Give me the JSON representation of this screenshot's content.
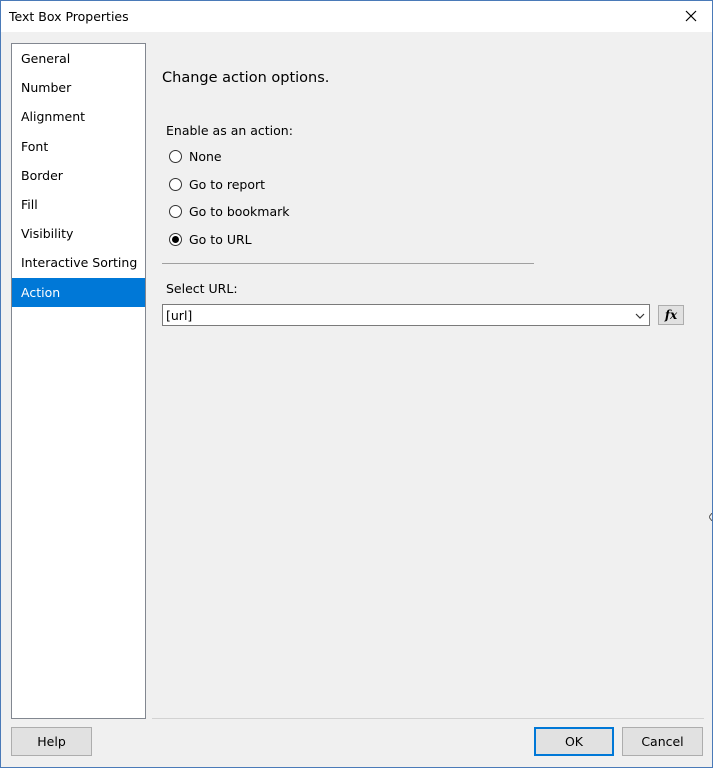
{
  "window": {
    "title": "Text Box Properties"
  },
  "nav": {
    "items": [
      {
        "label": "General"
      },
      {
        "label": "Number"
      },
      {
        "label": "Alignment"
      },
      {
        "label": "Font"
      },
      {
        "label": "Border"
      },
      {
        "label": "Fill"
      },
      {
        "label": "Visibility"
      },
      {
        "label": "Interactive Sorting"
      },
      {
        "label": "Action"
      }
    ],
    "selected": "Action"
  },
  "action_page": {
    "heading": "Change action options.",
    "enable_label": "Enable as an action:",
    "options": [
      {
        "label": "None",
        "checked": false
      },
      {
        "label": "Go to report",
        "checked": false
      },
      {
        "label": "Go to bookmark",
        "checked": false
      },
      {
        "label": "Go to URL",
        "checked": true
      }
    ],
    "select_url_label": "Select URL:",
    "url_value": "[url]",
    "fx_label": "fx"
  },
  "footer": {
    "help_label": "Help",
    "ok_label": "OK",
    "cancel_label": "Cancel"
  },
  "colors": {
    "selection": "#0078d7",
    "window_border": "#4a7ab8",
    "dialog_background": "#f0f0f0"
  }
}
